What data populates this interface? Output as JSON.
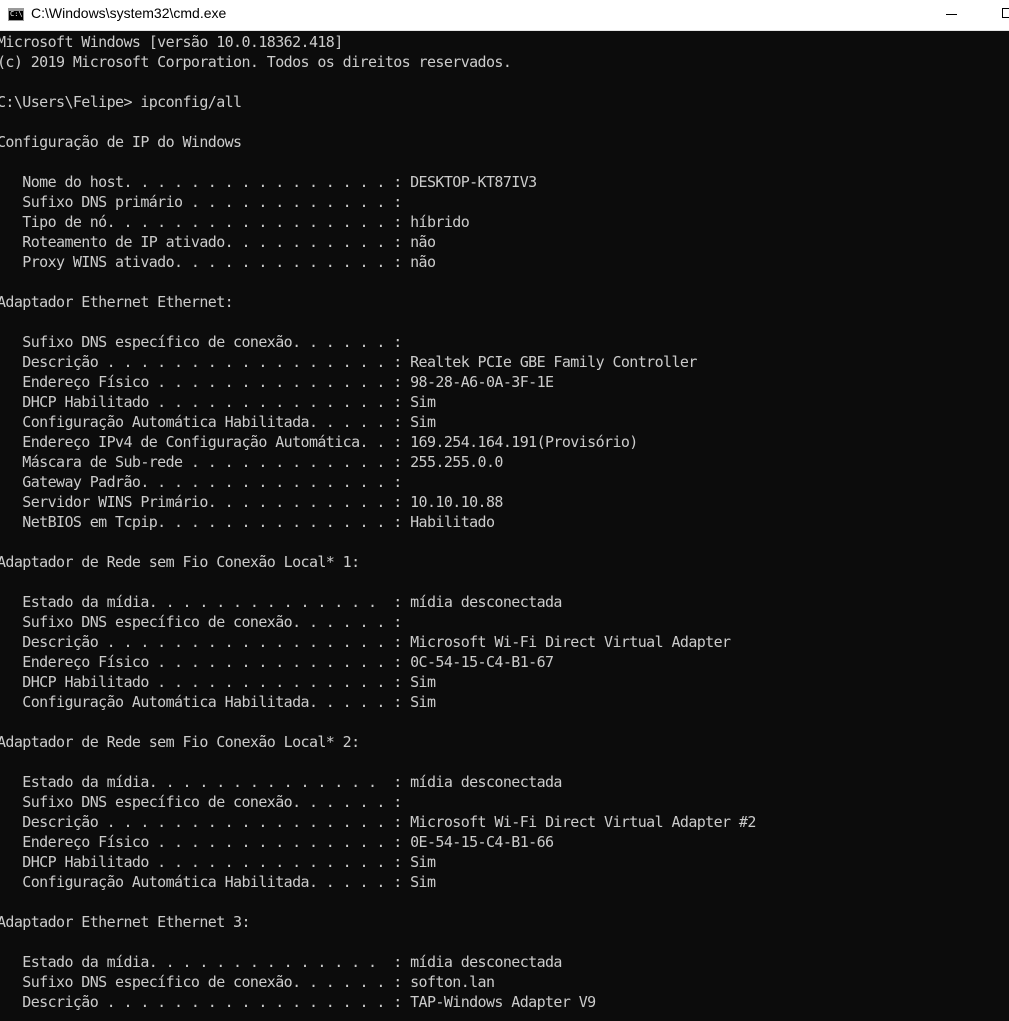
{
  "window": {
    "title": "C:\\Windows\\system32\\cmd.exe",
    "icon": "cmd-icon",
    "icon_text": "C:\\."
  },
  "console": {
    "lines": [
      "Microsoft Windows [versão 10.0.18362.418]",
      "(c) 2019 Microsoft Corporation. Todos os direitos reservados.",
      "",
      "C:\\Users\\Felipe> ipconfig/all",
      "",
      "Configuração de IP do Windows",
      "",
      "   Nome do host. . . . . . . . . . . . . . . . : DESKTOP-KT87IV3",
      "   Sufixo DNS primário . . . . . . . . . . . . :",
      "   Tipo de nó. . . . . . . . . . . . . . . . . : híbrido",
      "   Roteamento de IP ativado. . . . . . . . . . : não",
      "   Proxy WINS ativado. . . . . . . . . . . . . : não",
      "",
      "Adaptador Ethernet Ethernet:",
      "",
      "   Sufixo DNS específico de conexão. . . . . . :",
      "   Descrição . . . . . . . . . . . . . . . . . : Realtek PCIe GBE Family Controller",
      "   Endereço Físico . . . . . . . . . . . . . . : 98-28-A6-0A-3F-1E",
      "   DHCP Habilitado . . . . . . . . . . . . . . : Sim",
      "   Configuração Automática Habilitada. . . . . : Sim",
      "   Endereço IPv4 de Configuração Automática. . : 169.254.164.191(Provisório)",
      "   Máscara de Sub-rede . . . . . . . . . . . . : 255.255.0.0",
      "   Gateway Padrão. . . . . . . . . . . . . . . :",
      "   Servidor WINS Primário. . . . . . . . . . . : 10.10.10.88",
      "   NetBIOS em Tcpip. . . . . . . . . . . . . . : Habilitado",
      "",
      "Adaptador de Rede sem Fio Conexão Local* 1:",
      "",
      "   Estado da mídia. . . . . . . . . . . . . .  : mídia desconectada",
      "   Sufixo DNS específico de conexão. . . . . . :",
      "   Descrição . . . . . . . . . . . . . . . . . : Microsoft Wi-Fi Direct Virtual Adapter",
      "   Endereço Físico . . . . . . . . . . . . . . : 0C-54-15-C4-B1-67",
      "   DHCP Habilitado . . . . . . . . . . . . . . : Sim",
      "   Configuração Automática Habilitada. . . . . : Sim",
      "",
      "Adaptador de Rede sem Fio Conexão Local* 2:",
      "",
      "   Estado da mídia. . . . . . . . . . . . . .  : mídia desconectada",
      "   Sufixo DNS específico de conexão. . . . . . :",
      "   Descrição . . . . . . . . . . . . . . . . . : Microsoft Wi-Fi Direct Virtual Adapter #2",
      "   Endereço Físico . . . . . . . . . . . . . . : 0E-54-15-C4-B1-66",
      "   DHCP Habilitado . . . . . . . . . . . . . . : Sim",
      "   Configuração Automática Habilitada. . . . . : Sim",
      "",
      "Adaptador Ethernet Ethernet 3:",
      "",
      "   Estado da mídia. . . . . . . . . . . . . .  : mídia desconectada",
      "   Sufixo DNS específico de conexão. . . . . . : softon.lan",
      "   Descrição . . . . . . . . . . . . . . . . . : TAP-Windows Adapter V9"
    ]
  }
}
